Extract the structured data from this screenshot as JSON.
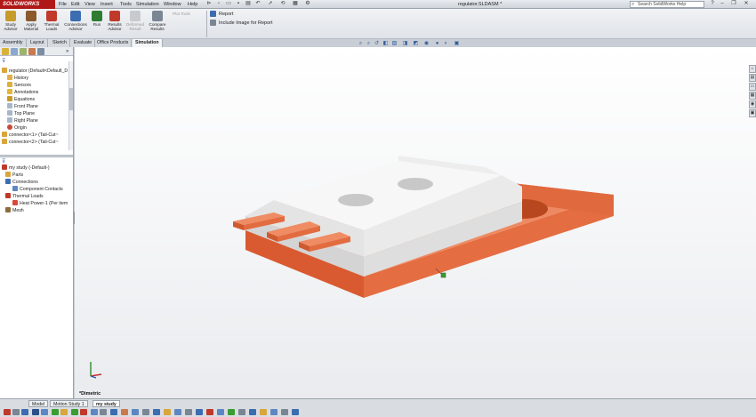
{
  "app": {
    "logo": "SOLIDWORKS",
    "doc_title": "regulator.SLDASM *",
    "help_search_placeholder": "Search SolidWorks Help"
  },
  "menu": [
    "File",
    "Edit",
    "View",
    "Insert",
    "Tools",
    "Simulation",
    "Window",
    "Help"
  ],
  "command_manager": {
    "buttons": [
      {
        "label": "Study Advisor",
        "color": "#c79b2a"
      },
      {
        "label": "Apply Material",
        "color": "#8a5a2e"
      },
      {
        "label": "Thermal Loads",
        "color": "#c0392b"
      },
      {
        "label": "Connections Advisor",
        "color": "#3c6db0"
      },
      {
        "label": "Run",
        "color": "#2e7d32"
      },
      {
        "label": "Results Advisor",
        "color": "#c0392b"
      },
      {
        "label": "Deformed Result",
        "color": "#9aa0a6"
      },
      {
        "label": "Compare Results",
        "color": "#7a8693"
      },
      {
        "label": "Plot Tools",
        "color": "#9aa0a6"
      }
    ],
    "report": "Report",
    "include_image": "Include Image for Report"
  },
  "tabs": [
    "Assembly",
    "Layout",
    "Sketch",
    "Evaluate",
    "Office Products",
    "Simulation"
  ],
  "active_tab": "Simulation",
  "feature_tree": [
    "regulator (Default<Default_D",
    "History",
    "Sensors",
    "Annotations",
    "Equations",
    "Front Plane",
    "Top Plane",
    "Right Plane",
    "Origin",
    "connector<1> (Tail-Cut~",
    "connector<2> (Tail-Cut~"
  ],
  "study_tree": [
    "my study (-Default-)",
    "Parts",
    "Connections",
    "Component Contacts",
    "Thermal Loads",
    "Heat Power-1 (Per item",
    "Mesh"
  ],
  "view_name": "*Dimetric",
  "bottom_tabs": [
    "Model",
    "Motion Study 1",
    "my study"
  ],
  "active_bottom_tab": "my study",
  "colors": {
    "accent": "#b01818",
    "part_copper": "#e2734b",
    "part_gray": "#e6e6e6"
  }
}
